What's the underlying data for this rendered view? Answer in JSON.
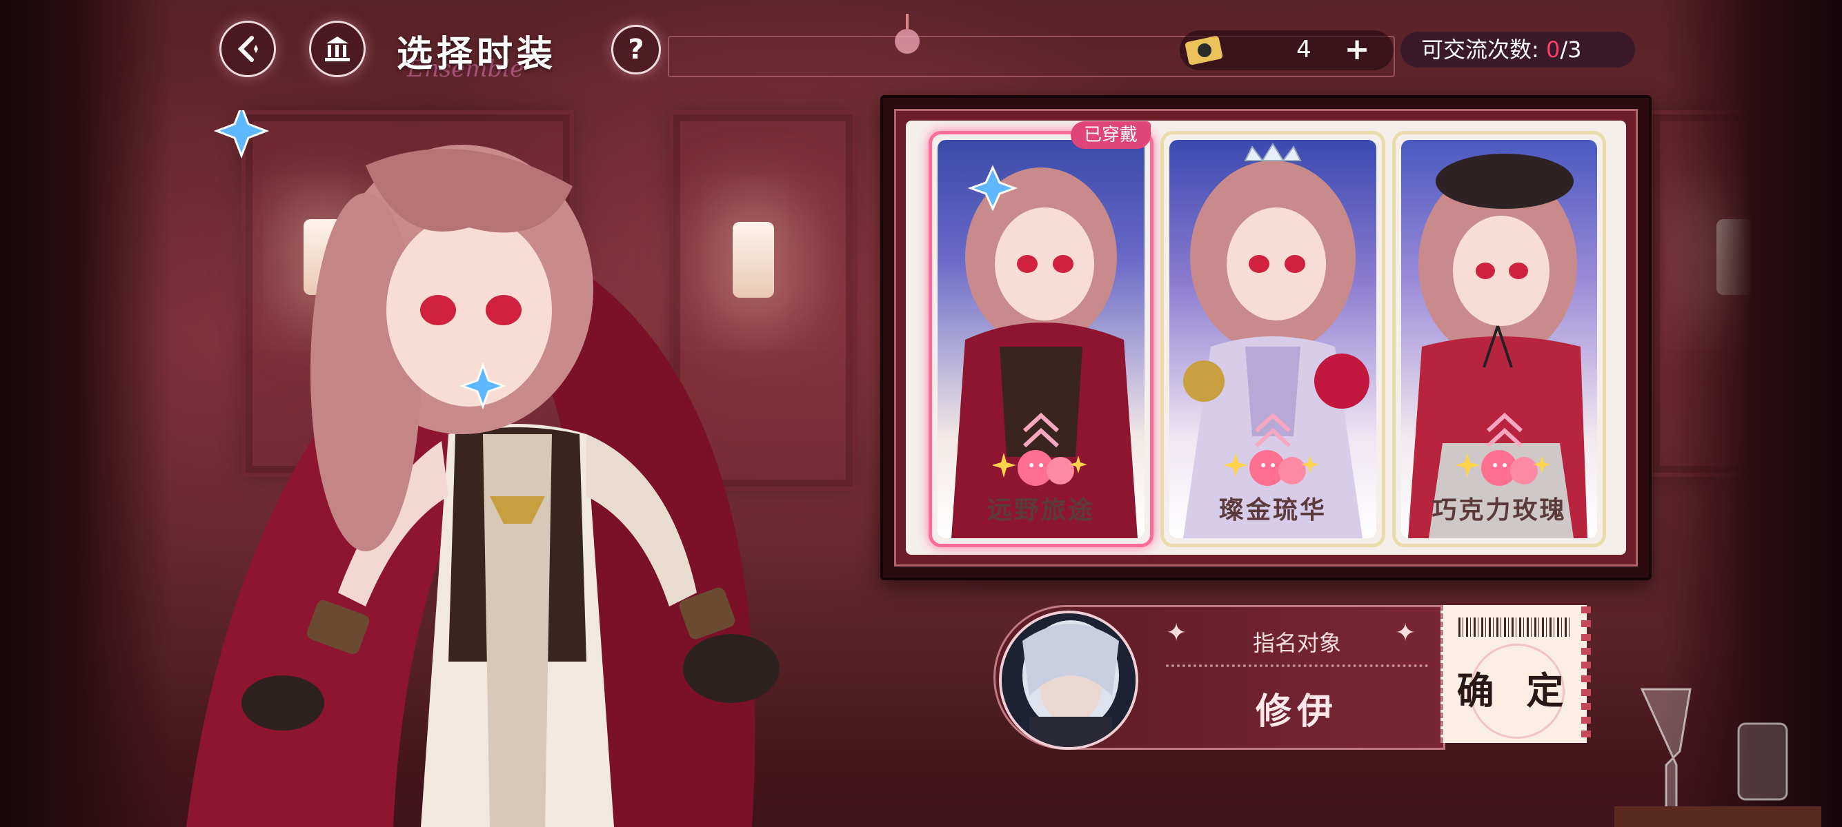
{
  "header": {
    "title": "选择时装",
    "title_deco": "Ensemble",
    "help_label": "?",
    "currency_value": "4",
    "add_label": "+",
    "exchange_label": "可交流次数: ",
    "exchange_used": "0",
    "exchange_total": "/3"
  },
  "costumes": {
    "worn_badge": "已穿戴",
    "items": [
      {
        "name": "远野旅途",
        "selected": true
      },
      {
        "name": "璨金琉华",
        "selected": false
      },
      {
        "name": "巧克力玫瑰",
        "selected": false
      }
    ]
  },
  "nomination": {
    "label": "指名对象",
    "name": "修伊",
    "confirm_label": "确 定"
  },
  "colors": {
    "accent_pink": "#ff6b98",
    "badge": "#e0457a",
    "counter_red": "#ff3e6c"
  }
}
